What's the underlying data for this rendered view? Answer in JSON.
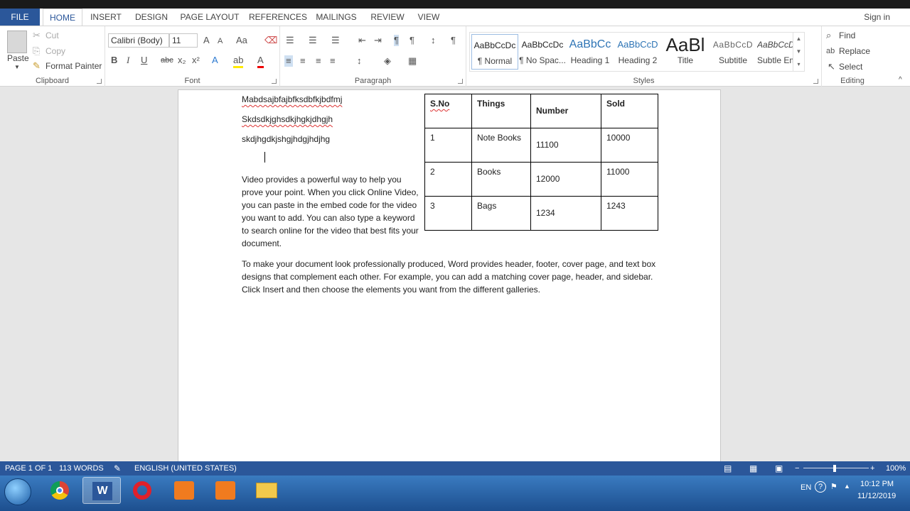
{
  "tabs": [
    "FILE",
    "HOME",
    "INSERT",
    "DESIGN",
    "PAGE LAYOUT",
    "REFERENCES",
    "MAILINGS",
    "REVIEW",
    "VIEW"
  ],
  "signin": "Sign in",
  "clipboard": {
    "paste": "Paste",
    "cut": "Cut",
    "copy": "Copy",
    "format_painter": "Format Painter",
    "label": "Clipboard"
  },
  "font": {
    "name": "Calibri (Body)",
    "size": "11",
    "label": "Font"
  },
  "paragraph": {
    "label": "Paragraph"
  },
  "styles": {
    "label": "Styles",
    "items": [
      {
        "preview": "AaBbCcDc",
        "name": "¶ Normal"
      },
      {
        "preview": "AaBbCcDc",
        "name": "¶ No Spac..."
      },
      {
        "preview": "AaBbCc",
        "name": "Heading 1"
      },
      {
        "preview": "AaBbCcD",
        "name": "Heading 2"
      },
      {
        "preview": "AaBl",
        "name": "Title"
      },
      {
        "preview": "AaBbCcD",
        "name": "Subtitle"
      },
      {
        "preview": "AaBbCcDc",
        "name": "Subtle Em..."
      }
    ]
  },
  "editing": {
    "find": "Find",
    "replace": "Replace",
    "select": "Select",
    "label": "Editing"
  },
  "document": {
    "line1": "Mabdsajbfajbfksdbfkjbdfmj",
    "line2": "Skdsdkjghsdkjhgkjdhgjh",
    "line3": "skdjhgdkjshgjhdgjhdjhg",
    "para1": "Video provides a powerful way to help you prove your point. When you click Online Video, you can paste in the embed code for the video you want to add. You can also type a keyword to search online for the video that best fits your document.",
    "para2": "To make your document look professionally produced, Word provides header, footer, cover page, and text box designs that complement each other. For example, you can add a matching cover page, header, and sidebar. Click Insert and then choose the elements you want from the different galleries.",
    "table": {
      "headers": [
        "S.No",
        "Things",
        "Number",
        "Sold"
      ],
      "rows": [
        [
          "1",
          "Note Books",
          "11100",
          "10000"
        ],
        [
          "2",
          "Books",
          "12000",
          "11000"
        ],
        [
          "3",
          "Bags",
          "1234",
          "1243"
        ]
      ]
    }
  },
  "status": {
    "page": "PAGE 1 OF 1",
    "words": "113 WORDS",
    "lang": "ENGLISH (UNITED STATES)",
    "zoom": "100%"
  },
  "tray": {
    "lang": "EN",
    "time": "10:12 PM",
    "date": "11/12/2019"
  },
  "colors": {
    "accent": "#2b579a",
    "taskbar": "#2a65a8"
  }
}
